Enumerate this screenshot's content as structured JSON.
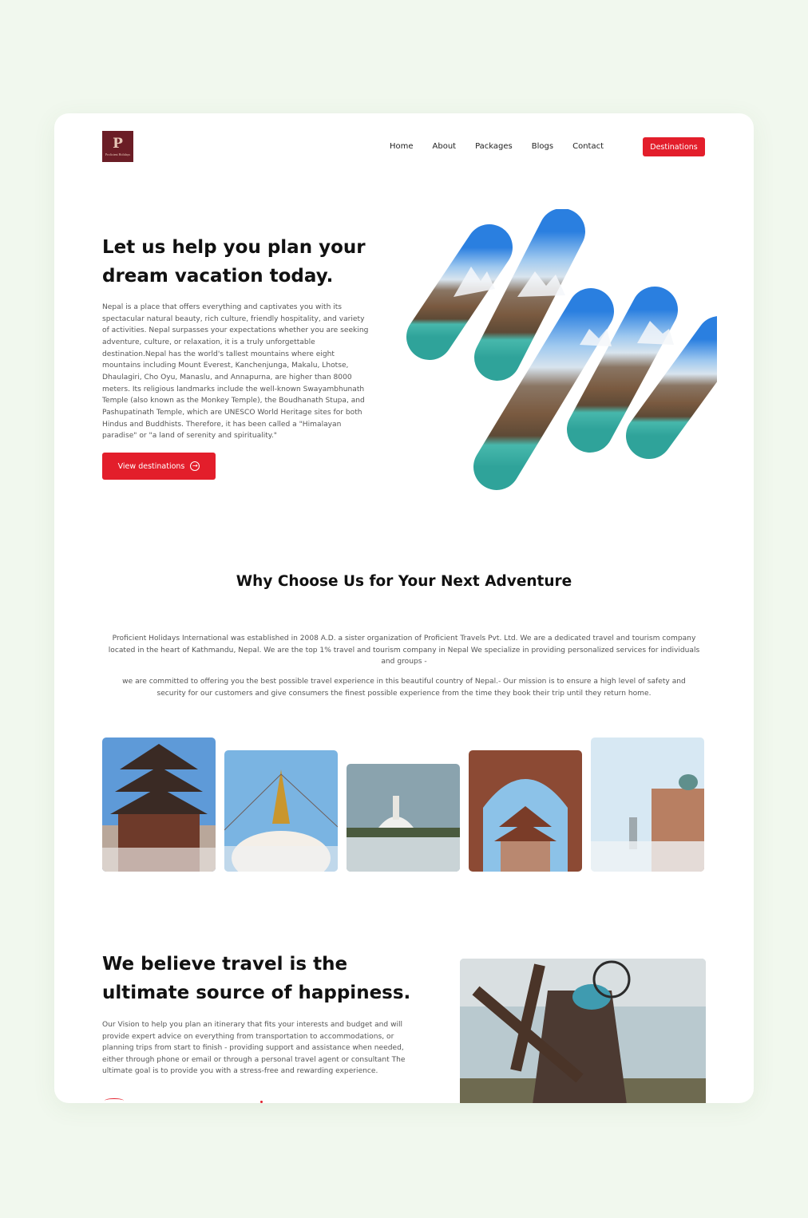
{
  "header": {
    "logo": {
      "mark": "P",
      "brand": "Proficient Holidays"
    },
    "nav": [
      "Home",
      "About",
      "Packages",
      "Blogs",
      "Contact"
    ],
    "cta_label": "Destinations"
  },
  "hero": {
    "title": "Let us help you plan your dream vacation today.",
    "body": "Nepal is a place that offers everything and captivates you with its spectacular natural beauty, rich culture, friendly hospitality, and variety of activities. Nepal surpasses your expectations whether you are seeking adventure, culture, or relaxation, it is a truly unforgettable destination.Nepal has the world's tallest mountains where eight mountains including Mount Everest, Kanchenjunga, Makalu, Lhotse, Dhaulagiri, Cho Oyu, Manaslu, and Annapurna, are higher than 8000 meters. Its religious landmarks include the well-known Swayambhunath Temple (also known as the Monkey Temple), the Boudhanath Stupa, and Pashupatinath Temple, which are UNESCO World Heritage sites for both Hindus and Buddhists. Therefore, it has been called a \"Himalayan paradise\" or \"a land of serenity and spirituality.\"",
    "button_label": "View destinations",
    "button_icon": "arrow-right-circle-icon"
  },
  "why": {
    "title": "Why Choose Us for Your Next Adventure",
    "p1": "Proficient Holidays International was established in 2008 A.D. a sister organization of Proficient Travels Pvt. Ltd. We are a dedicated travel and tourism company located in the heart of Kathmandu, Nepal. We are the top 1% travel and tourism company in Nepal We specialize in providing personalized services for individuals and groups -",
    "p2": "we are committed to offering you the best possible travel experience in this beautiful country of Nepal.- Our mission is  to ensure a high level of safety and security for our customers and   give consumers the finest possible experience from the time they book their trip until they return home."
  },
  "gallery": [
    "pagoda-temple",
    "boudhanath-stupa",
    "white-stupa-lake",
    "temple-through-arch",
    "palace-domes"
  ],
  "happiness": {
    "title": "We believe travel is the ultimate source of happiness.",
    "body": "Our Vision to help you plan an itinerary that fits your interests and budget and will provide expert advice on everything from transportation to accommodations, or planning trips from start to finish - providing support and assistance when needed, either through phone or email or through a personal travel agent or consultant The ultimate goal is to provide you with a stress-free and rewarding experience."
  },
  "colors": {
    "accent": "#e31e2b",
    "page_bg": "#f1f8ee",
    "logo_bg": "#6b1d26"
  }
}
